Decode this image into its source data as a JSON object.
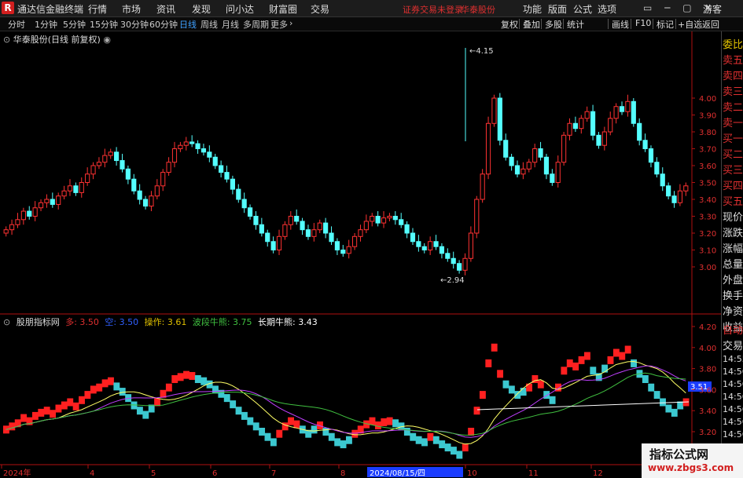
{
  "app": {
    "logo_text": "R",
    "title": "通达信金融终端",
    "menu": [
      "行情",
      "市场",
      "资讯",
      "发现",
      "问小达",
      "财富圈",
      "交易"
    ],
    "login_status": "证券交易未登录",
    "broker": "华泰股份",
    "right_menu": [
      "功能",
      "版面",
      "公式",
      "选项"
    ],
    "window_controls": "▭ ─ ▢ ✕",
    "guest": "游客"
  },
  "periods": {
    "items": [
      "分时",
      "1分钟",
      "5分钟",
      "15分钟",
      "30分钟",
      "60分钟",
      "日线",
      "周线",
      "月线",
      "多周期",
      "更多"
    ],
    "active": "日线"
  },
  "toolbar": [
    "复权",
    "叠加",
    "多股",
    "统计",
    "画线",
    "F10",
    "标记",
    "+自选",
    "返回"
  ],
  "chart": {
    "title": "华泰股份(日线 前复权)",
    "price_labels": [
      "4.00",
      "3.90",
      "3.80",
      "3.70",
      "3.60",
      "3.50",
      "3.40",
      "3.30",
      "3.20",
      "3.10",
      "3.00"
    ],
    "high_label": "4.15",
    "low_label": "2.94",
    "date_labels": [
      "2024年",
      "4",
      "5",
      "6",
      "7",
      "8",
      "2024/08/15/四",
      "10",
      "11",
      "12"
    ]
  },
  "indicator": {
    "name": "股朋指标网",
    "items": [
      {
        "label": "多: 3.50",
        "color": "#e03030"
      },
      {
        "label": "空: 3.50",
        "color": "#3060ff"
      },
      {
        "label": "操作: 3.61",
        "color": "#e0c000"
      },
      {
        "label": "波段牛熊: 3.75",
        "color": "#40c040"
      },
      {
        "label": "长期牛熊: 3.43",
        "color": "#ffffff"
      }
    ],
    "price_labels": [
      "4.20",
      "4.00",
      "3.80",
      "3.60",
      "3.40",
      "3.20"
    ],
    "current_value": "3.51"
  },
  "sidepanel": {
    "items": [
      "委比",
      "卖五",
      "卖四",
      "卖三",
      "卖二",
      "卖一",
      "买一",
      "买二",
      "买三",
      "买四",
      "买五",
      "现价",
      "涨跌",
      "涨幅",
      "总量",
      "外盘",
      "换手",
      "净资",
      "收益",
      "自动",
      "交易"
    ],
    "times": [
      "14:55",
      "14:56",
      "14:56",
      "14:56",
      "14:56",
      "14:56",
      "14:56",
      "14:56",
      "14:56",
      "14:56"
    ]
  },
  "chart_data": {
    "type": "candlestick",
    "title": "华泰股份(日线 前复权)",
    "ylim": [
      2.9,
      4.2
    ],
    "high": 4.15,
    "low": 2.94,
    "closes": [
      3.22,
      3.25,
      3.28,
      3.33,
      3.3,
      3.35,
      3.38,
      3.4,
      3.37,
      3.42,
      3.45,
      3.48,
      3.44,
      3.5,
      3.55,
      3.6,
      3.62,
      3.66,
      3.68,
      3.63,
      3.58,
      3.52,
      3.45,
      3.4,
      3.36,
      3.42,
      3.48,
      3.56,
      3.62,
      3.7,
      3.72,
      3.74,
      3.73,
      3.7,
      3.68,
      3.65,
      3.6,
      3.56,
      3.52,
      3.46,
      3.4,
      3.35,
      3.3,
      3.25,
      3.2,
      3.15,
      3.1,
      3.18,
      3.25,
      3.3,
      3.27,
      3.22,
      3.18,
      3.22,
      3.26,
      3.2,
      3.15,
      3.1,
      3.08,
      3.12,
      3.18,
      3.22,
      3.27,
      3.3,
      3.26,
      3.29,
      3.3,
      3.28,
      3.25,
      3.2,
      3.15,
      3.12,
      3.1,
      3.15,
      3.12,
      3.08,
      3.05,
      3.02,
      2.98,
      3.05,
      3.2,
      3.4,
      3.55,
      3.85,
      4.0,
      3.75,
      3.65,
      3.6,
      3.55,
      3.58,
      3.62,
      3.7,
      3.65,
      3.55,
      3.5,
      3.62,
      3.78,
      3.85,
      3.82,
      3.88,
      3.92,
      3.78,
      3.72,
      3.8,
      3.88,
      3.95,
      3.92,
      3.98,
      3.85,
      3.75,
      3.7,
      3.62,
      3.55,
      3.48,
      3.42,
      3.38,
      3.45,
      3.48
    ],
    "indicator": {
      "ylim": [
        3.1,
        4.25
      ],
      "current": 3.51
    }
  }
}
